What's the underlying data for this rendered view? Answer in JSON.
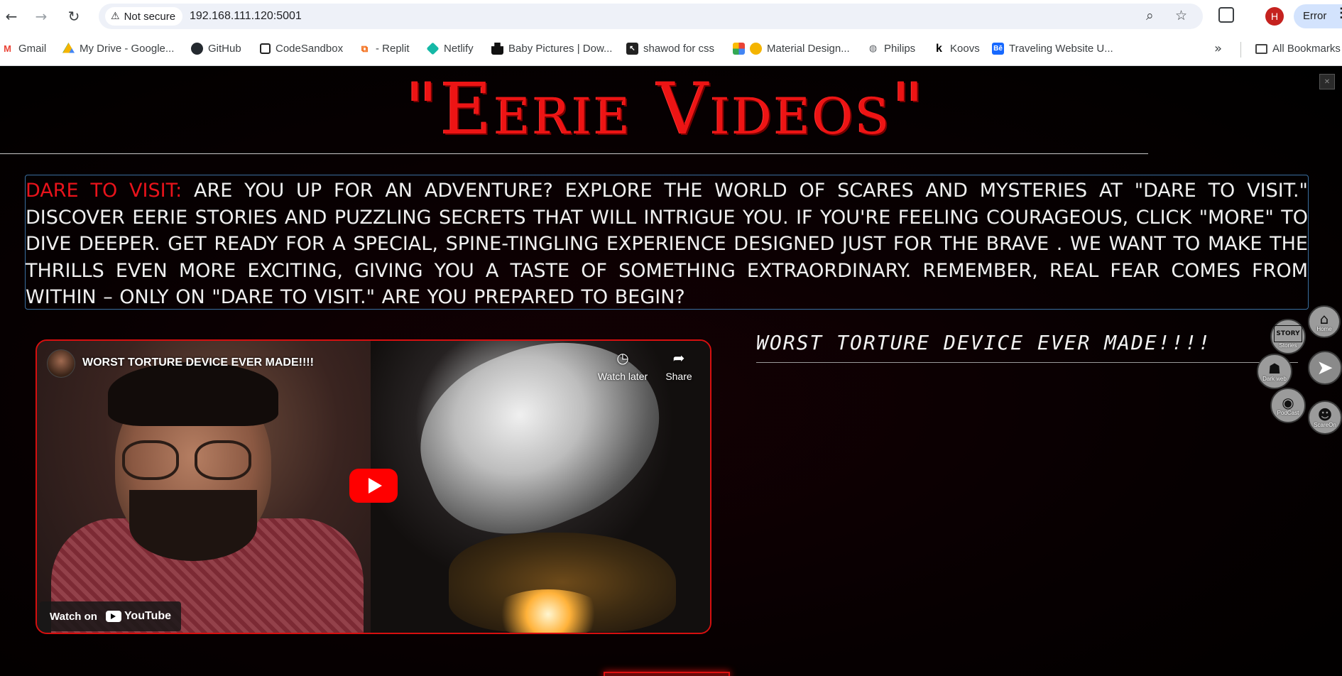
{
  "browser": {
    "security_label": "Not secure",
    "url": "192.168.111.120:5001",
    "profile_initial": "H",
    "status_label": "Error",
    "bookmarks": [
      {
        "label": "Gmail",
        "icon": "gmail-icon"
      },
      {
        "label": "My Drive - Google...",
        "icon": "google-drive-icon"
      },
      {
        "label": "GitHub",
        "icon": "github-icon"
      },
      {
        "label": "CodeSandbox",
        "icon": "codesandbox-icon"
      },
      {
        "label": "- Replit",
        "icon": "replit-icon"
      },
      {
        "label": "Netlify",
        "icon": "netlify-icon"
      },
      {
        "label": "Baby Pictures | Dow...",
        "icon": "unsplash-icon"
      },
      {
        "label": "shawod for css",
        "icon": "cursor-icon"
      },
      {
        "label": "Material Design...",
        "icon": "material-icon"
      },
      {
        "label": "Philips",
        "icon": "globe-icon"
      },
      {
        "label": "Koovs",
        "icon": "koovs-icon"
      },
      {
        "label": "Traveling Website U...",
        "icon": "behance-icon"
      }
    ],
    "all_bookmarks_label": "All Bookmarks"
  },
  "page": {
    "title": "\"Eerie Videos\"",
    "intro_lead": "Dare to Visit:",
    "intro_body": " Are you up for an adventure? Explore the world of scares and mysteries at \"Dare to Visit.\" Discover eerie stories and puzzling secrets that will intrigue you. If you're feeling courageous, click \"More\" to dive deeper. Get ready for a special, spine-tingling experience designed just for the brave . We want to make the thrills even more exciting, giving you a taste of something extraordinary. Remember, real fear comes from within – only on \"Dare to Visit.\" Are you prepared to begin?",
    "video": {
      "title": "WORST TORTURE DEVICE EVER MADE!!!!",
      "watch_later": "Watch later",
      "share": "Share",
      "watch_on": "Watch on",
      "youtube": "YouTube"
    },
    "video_heading": "WORST TORTURE DEVICE EVER MADE!!!!"
  },
  "floating_nav": [
    {
      "label": "Home",
      "icon": "haunted-house-icon"
    },
    {
      "label": "Stories",
      "icon": "story-icon"
    },
    {
      "label": "",
      "icon": "send-arrow-icon"
    },
    {
      "label": "Dark web",
      "icon": "hacker-icon"
    },
    {
      "label": "PodCast",
      "icon": "microphone-icon"
    },
    {
      "label": "ScareOn",
      "icon": "scare-user-icon"
    }
  ]
}
